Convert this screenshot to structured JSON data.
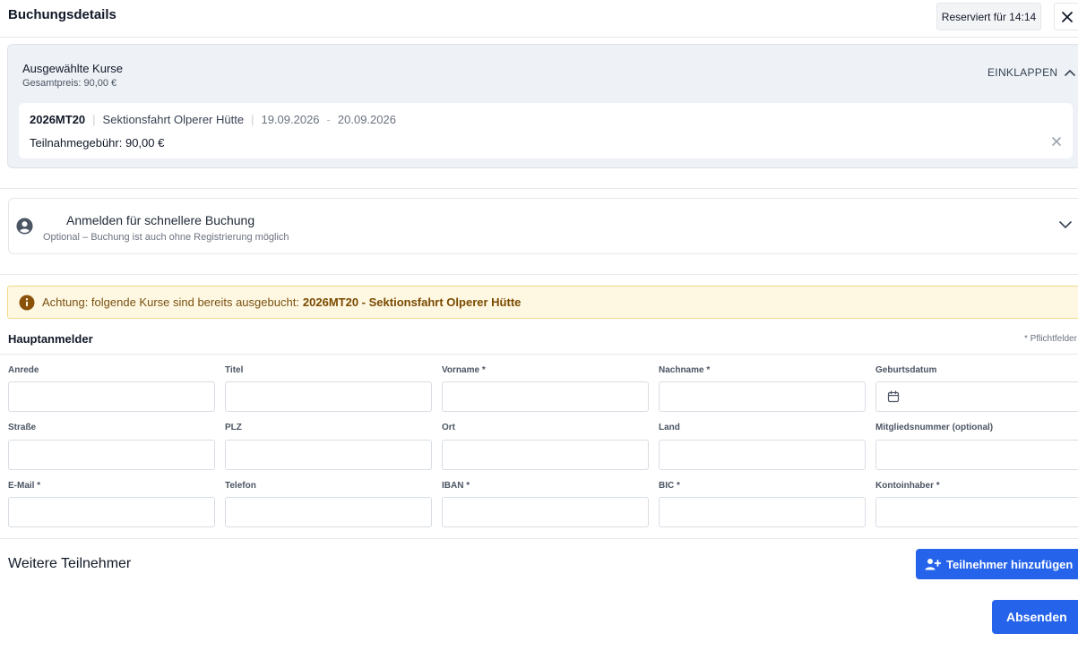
{
  "header": {
    "title": "Buchungsdetails",
    "reserved_label": "Reserviert für 14:14"
  },
  "selected_courses": {
    "title": "Ausgewählte Kurse",
    "total_price": "Gesamtpreis: 90,00 €",
    "collapse_label": "EINKLAPPEN",
    "items": [
      {
        "code": "2026MT20",
        "name": "Sektionsfahrt Olperer Hütte",
        "date_from": "19.09.2026",
        "date_separator": "-",
        "date_to": "20.09.2026",
        "fee": "Teilnahmegebühr: 90,00 €"
      }
    ]
  },
  "login": {
    "title": "Anmelden für schnellere Buchung",
    "subtitle": "Optional – Buchung ist auch ohne Registrierung möglich"
  },
  "warning": {
    "text": "Achtung: folgende Kurse sind bereits ausgebucht:",
    "course": "2026MT20 - Sektionsfahrt Olperer Hütte"
  },
  "main_registrant": {
    "title": "Hauptanmelder",
    "required_note": "* Pflichtfelder",
    "fields": [
      {
        "label": "Anrede",
        "value": ""
      },
      {
        "label": "Titel",
        "value": ""
      },
      {
        "label": "Vorname *",
        "value": ""
      },
      {
        "label": "Nachname *",
        "value": ""
      },
      {
        "label": "Geburtsdatum",
        "value": ""
      },
      {
        "label": "Straße",
        "value": ""
      },
      {
        "label": "PLZ",
        "value": ""
      },
      {
        "label": "Ort",
        "value": ""
      },
      {
        "label": "Land",
        "value": ""
      },
      {
        "label": "Mitgliedsnummer (optional)",
        "value": ""
      },
      {
        "label": "E-Mail *",
        "value": ""
      },
      {
        "label": "Telefon",
        "value": ""
      },
      {
        "label": "IBAN *",
        "value": ""
      },
      {
        "label": "BIC *",
        "value": ""
      },
      {
        "label": "Kontoinhaber *",
        "value": ""
      }
    ]
  },
  "further_participants": {
    "title": "Weitere Teilnehmer",
    "add_button": "Teilnehmer hinzufügen"
  },
  "submit_label": "Absenden",
  "colors": {
    "primary": "#2563eb",
    "warning_bg": "#fef8e3",
    "warning_border": "#f2d88b",
    "courses_bg": "#eef2f7"
  },
  "icons": [
    "close-icon",
    "chevron-up-icon",
    "close-icon",
    "user-circle-icon",
    "chevron-down-icon",
    "info-icon",
    "calendar-icon",
    "user-plus-icon"
  ]
}
